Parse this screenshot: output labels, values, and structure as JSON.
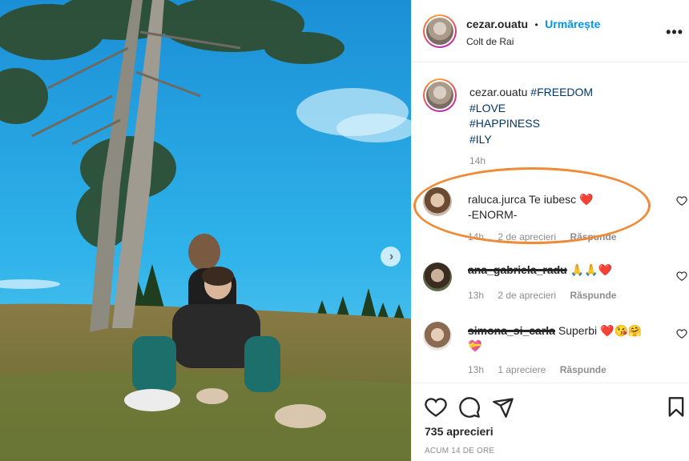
{
  "post": {
    "username": "cezar.ouatu",
    "separator": "•",
    "follow_label": "Urmărește",
    "location": "Colt de Rai",
    "more_icon": "more-options-icon"
  },
  "caption": {
    "username": "cezar.ouatu",
    "tags": [
      "#FREEDOM",
      "#LOVE",
      "#HAPPINESS",
      "#ILY"
    ],
    "time": "14h"
  },
  "comments": [
    {
      "username": "raluca.jurca",
      "text": "Te iubesc",
      "emoji": "❤️",
      "text2": "-ENORM-",
      "time": "14h",
      "likes": "2 de aprecieri",
      "reply": "Răspunde"
    },
    {
      "username": "ana_gabriela_radu",
      "text": "",
      "emoji": "🙏🙏❤️",
      "time": "13h",
      "likes": "2 de aprecieri",
      "reply": "Răspunde"
    },
    {
      "username": "simona_si_carla",
      "text": "Superbi",
      "emoji": "❤️😘🤗",
      "emoji2": "💝",
      "time": "13h",
      "likes": "1 apreciere",
      "reply": "Răspunde"
    }
  ],
  "footer": {
    "likes": "735 aprecieri",
    "posted": "ACUM 14 DE ORE"
  },
  "colors": {
    "follow": "#0095f6",
    "hashtag": "#00376b",
    "muted": "#8e8e8e",
    "highlight_oval": "#f08a34",
    "sky": "#2aa8e6"
  }
}
